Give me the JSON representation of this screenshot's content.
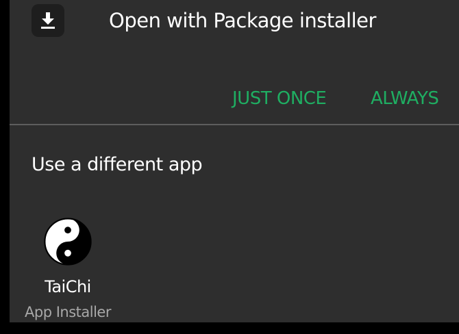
{
  "dialog": {
    "title": "Open with Package installer",
    "header_icon": "download-icon",
    "buttons": {
      "just_once": "JUST ONCE",
      "always": "ALWAYS"
    },
    "section_title": "Use a different app",
    "apps": [
      {
        "name": "TaiChi",
        "subtitle": "App Installer",
        "icon": "yin-yang-icon"
      }
    ]
  },
  "colors": {
    "background": "#2e2e2e",
    "accent": "#1fae62",
    "text_primary": "#ffffff",
    "text_secondary": "#a8a8a8",
    "divider": "#5e5e5e"
  }
}
